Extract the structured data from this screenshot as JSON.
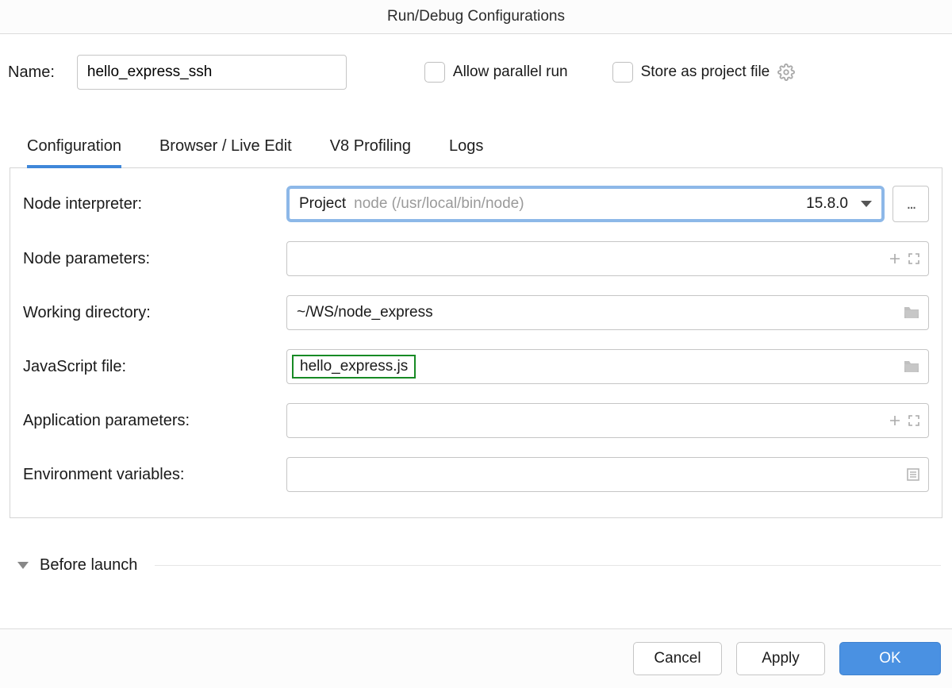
{
  "window_title": "Run/Debug Configurations",
  "top": {
    "name_label": "Name:",
    "name_value": "hello_express_ssh",
    "allow_parallel_label": "Allow parallel run",
    "store_project_label": "Store as project file"
  },
  "tabs": {
    "configuration": "Configuration",
    "browser": "Browser / Live Edit",
    "v8": "V8 Profiling",
    "logs": "Logs"
  },
  "form": {
    "node_interpreter_label": "Node interpreter:",
    "interpreter_name": "Project",
    "interpreter_path": "node (/usr/local/bin/node)",
    "interpreter_version": "15.8.0",
    "browse_ellipsis": "...",
    "node_params_label": "Node parameters:",
    "node_params_value": "",
    "working_dir_label": "Working directory:",
    "working_dir_value": "~/WS/node_express",
    "js_file_label": "JavaScript file:",
    "js_file_value": "hello_express.js",
    "app_params_label": "Application parameters:",
    "app_params_value": "",
    "env_vars_label": "Environment variables:",
    "env_vars_value": ""
  },
  "before_launch_label": "Before launch",
  "footer": {
    "cancel": "Cancel",
    "apply": "Apply",
    "ok": "OK"
  }
}
